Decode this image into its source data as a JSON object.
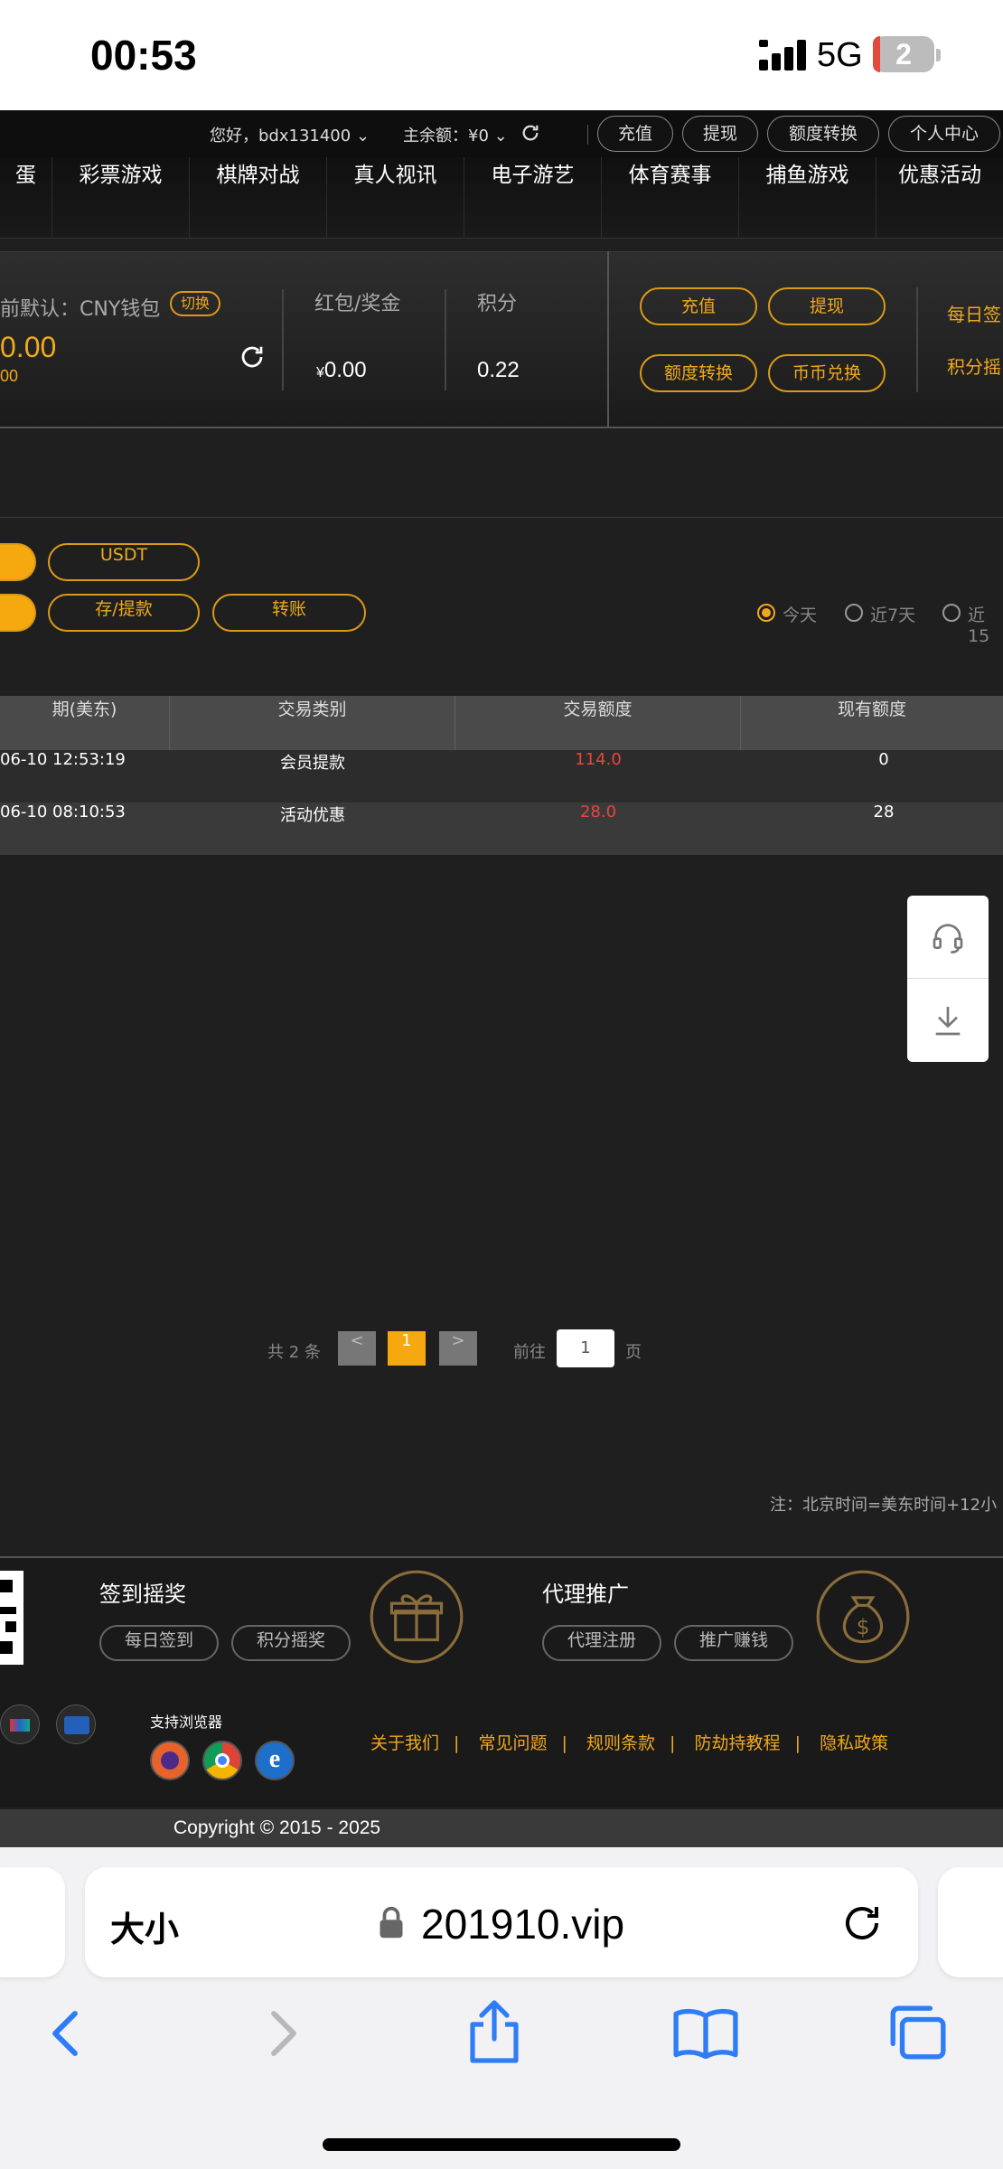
{
  "status_bar": {
    "time": "00:53",
    "network": "5G",
    "battery": "2"
  },
  "user_bar": {
    "greeting": "您好，bdx131400",
    "balance": "主余额：¥0",
    "buttons": [
      "充值",
      "提现",
      "额度转换",
      "个人中心"
    ]
  },
  "nav": {
    "items": [
      "蛋",
      "彩票游戏",
      "棋牌对战",
      "真人视讯",
      "电子游艺",
      "体育赛事",
      "捕鱼游戏",
      "优惠活动"
    ]
  },
  "wallet": {
    "default_label": "前默认：CNY钱包",
    "switch_label": "切换",
    "main_amount": "0.00",
    "sub_amount": "00",
    "red_packet_label": "红包/奖金",
    "red_packet_currency": "¥",
    "red_packet_value": "0.00",
    "points_label": "积分",
    "points_value": "0.22",
    "actions": [
      "充值",
      "提现",
      "额度转换",
      "币币兑换"
    ],
    "side_links": [
      "每日签",
      "积分摇"
    ]
  },
  "filters": {
    "row1": [
      "USDT"
    ],
    "row2": [
      "存/提款",
      "转账"
    ],
    "range": [
      "今天",
      "近7天",
      "近15"
    ]
  },
  "table": {
    "headers": [
      "期(美东)",
      "交易类别",
      "交易额度",
      "现有额度"
    ],
    "rows": [
      [
        "06-10 12:53:19",
        "会员提款",
        "114.0",
        "0"
      ],
      [
        "06-10 08:10:53",
        "活动优惠",
        "28.0",
        "28"
      ]
    ]
  },
  "pagination": {
    "total": "共 2 条",
    "prev": "<",
    "current": "1",
    "next": ">",
    "goto_label": "前往",
    "goto_value": "1",
    "page_suffix": "页"
  },
  "note": "注：北京时间=美东时间+12小",
  "footer": {
    "sign_title": "签到摇奖",
    "sign_buttons": [
      "每日签到",
      "积分摇奖"
    ],
    "agent_title": "代理推广",
    "agent_buttons": [
      "代理注册",
      "推广赚钱"
    ],
    "browser_label": "支持浏览器",
    "links": [
      "关于我们",
      "常见问题",
      "规则条款",
      "防劫持教程",
      "隐私政策"
    ],
    "copyright": "Copyright © 2015 - 2025"
  },
  "safari": {
    "text_size": "大小",
    "url": "201910.vip"
  },
  "colors": {
    "accent": "#f0a91c",
    "negative": "#e8453c",
    "bg": "#1f1f1f"
  }
}
